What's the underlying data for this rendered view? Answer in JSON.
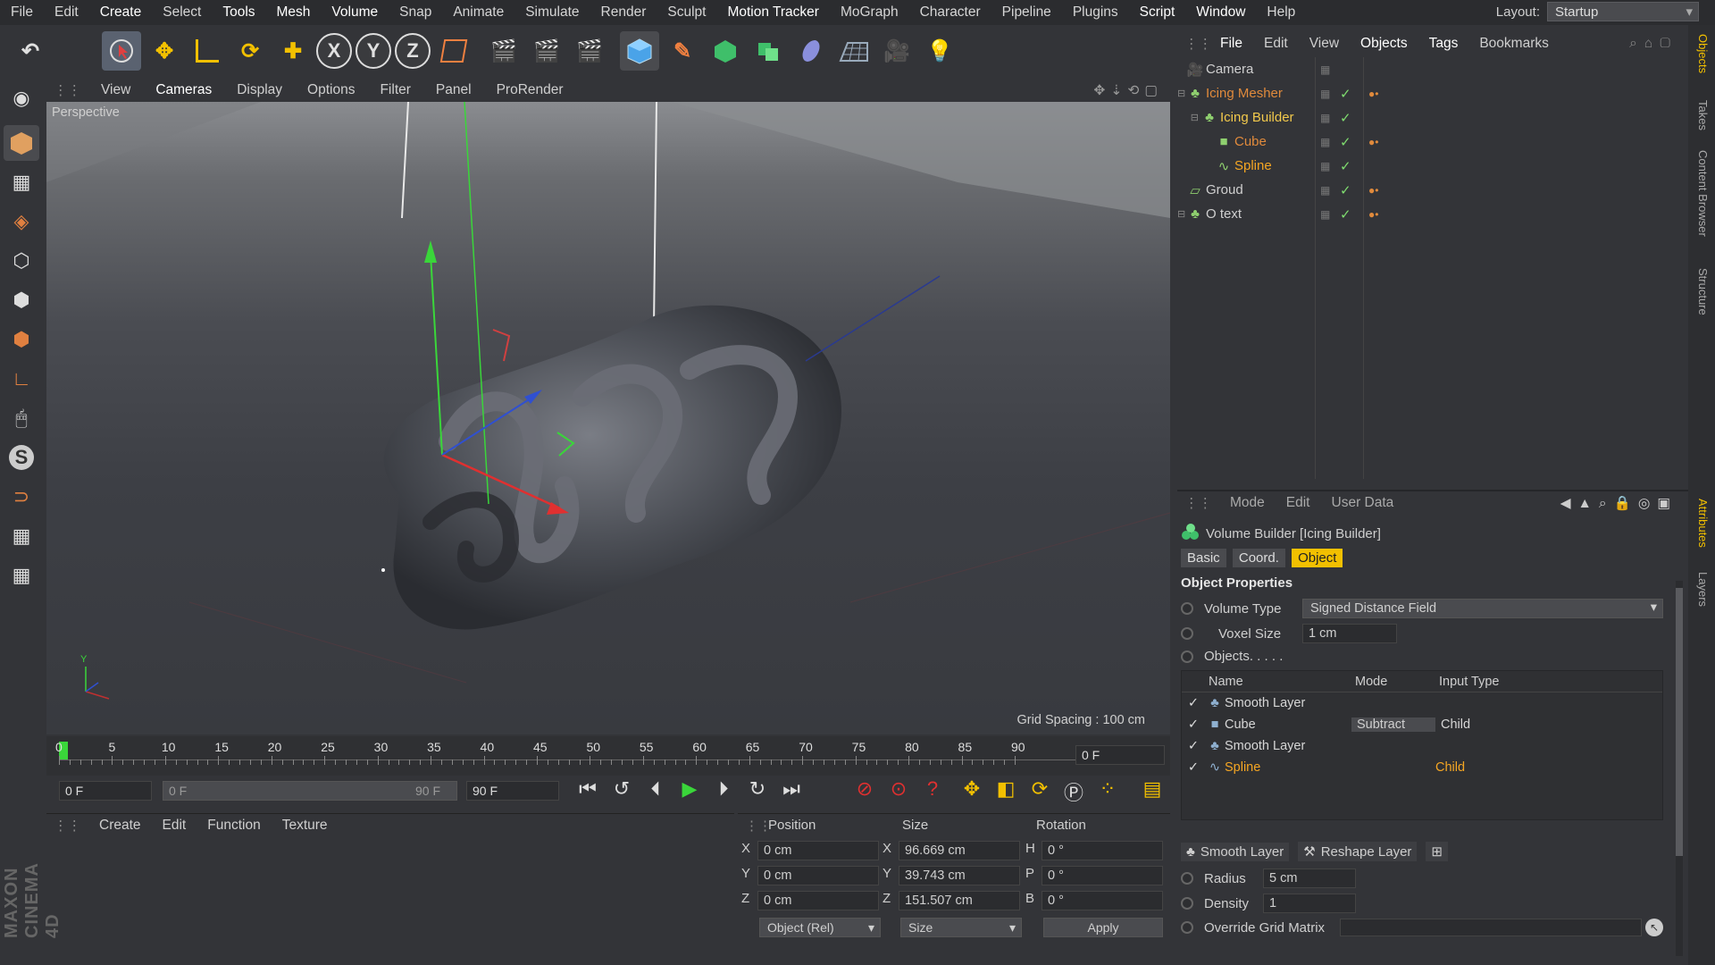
{
  "menubar": {
    "items": [
      "File",
      "Edit",
      "Create",
      "Select",
      "Tools",
      "Mesh",
      "Volume",
      "Snap",
      "Animate",
      "Simulate",
      "Render",
      "Sculpt",
      "Motion Tracker",
      "MoGraph",
      "Character",
      "Pipeline",
      "Plugins",
      "Script",
      "Window",
      "Help"
    ],
    "layout_label": "Layout:",
    "layout_value": "Startup"
  },
  "toolbar": {
    "axis_x": "X",
    "axis_y": "Y",
    "axis_z": "Z"
  },
  "viewport": {
    "menu": [
      "View",
      "Cameras",
      "Display",
      "Options",
      "Filter",
      "Panel",
      "ProRender"
    ],
    "label": "Perspective",
    "grid_spacing": "Grid Spacing : 100 cm",
    "axis_y": "Y"
  },
  "timeline": {
    "ticks": [
      "0",
      "5",
      "10",
      "15",
      "20",
      "25",
      "30",
      "35",
      "40",
      "45",
      "50",
      "55",
      "60",
      "65",
      "70",
      "75",
      "80",
      "85",
      "90"
    ],
    "current_frame": "0 F"
  },
  "transport": {
    "start_frame": "0 F",
    "range_start": "0 F",
    "range_end": "90 F",
    "end_frame": "90 F"
  },
  "material_panel": {
    "menu": [
      "Create",
      "Edit",
      "Function",
      "Texture"
    ],
    "brand_text": "MAXON CINEMA 4D"
  },
  "coord_panel": {
    "headers": {
      "position": "Position",
      "size": "Size",
      "rotation": "Rotation"
    },
    "rows": [
      {
        "axis": "X",
        "pos": "0 cm",
        "size_axis": "X",
        "size": "96.669 cm",
        "rot_axis": "H",
        "rot": "0 °"
      },
      {
        "axis": "Y",
        "pos": "0 cm",
        "size_axis": "Y",
        "size": "39.743 cm",
        "rot_axis": "P",
        "rot": "0 °"
      },
      {
        "axis": "Z",
        "pos": "0 cm",
        "size_axis": "Z",
        "size": "151.507 cm",
        "rot_axis": "B",
        "rot": "0 °"
      }
    ],
    "mode_select": "Object (Rel)",
    "size_select": "Size",
    "apply": "Apply"
  },
  "objects_panel": {
    "menu": [
      "File",
      "Edit",
      "View",
      "Objects",
      "Tags",
      "Bookmarks"
    ],
    "items": [
      {
        "name": "Camera",
        "color": "#cfcfcf",
        "indent": 0
      },
      {
        "name": "Icing Mesher",
        "color": "#e08a3c",
        "indent": 0
      },
      {
        "name": "Icing Builder",
        "color": "#f2c94c",
        "indent": 1
      },
      {
        "name": "Cube",
        "color": "#e08a3c",
        "indent": 2
      },
      {
        "name": "Spline",
        "color": "#f5a623",
        "indent": 2
      },
      {
        "name": "Groud",
        "color": "#cfcfcf",
        "indent": 0
      },
      {
        "name": "O text",
        "color": "#cfcfcf",
        "indent": 0
      }
    ]
  },
  "attributes_panel": {
    "menu": [
      "Mode",
      "Edit",
      "User Data"
    ],
    "title": "Volume Builder [Icing Builder]",
    "tabs": [
      "Basic",
      "Coord.",
      "Object"
    ],
    "active_tab": "Object",
    "section": "Object Properties",
    "volume_type_label": "Volume Type",
    "volume_type_value": "Signed Distance Field",
    "voxel_size_label": "Voxel Size",
    "voxel_size_value": "1 cm",
    "objects_label": "Objects. . . . .",
    "list_headers": {
      "name": "Name",
      "mode": "Mode",
      "input_type": "Input Type"
    },
    "list_rows": [
      {
        "name": "Smooth Layer",
        "mode": "",
        "input": ""
      },
      {
        "name": "Cube",
        "mode": "Subtract",
        "input": "Child"
      },
      {
        "name": "Smooth Layer",
        "mode": "",
        "input": ""
      },
      {
        "name": "Spline",
        "mode": "",
        "input": "Child"
      }
    ],
    "smooth_layer_btn": "Smooth Layer",
    "reshape_layer_btn": "Reshape Layer",
    "radius_label": "Radius",
    "radius_value": "5 cm",
    "density_label": "Density",
    "density_value": "1",
    "override_label": "Override Grid Matrix"
  },
  "right_strip": [
    "Objects",
    "Takes",
    "Content Browser",
    "Structure",
    "Attributes",
    "Layers"
  ],
  "colors": {
    "accent": "#f2c000",
    "highlight": "#f5a623",
    "check": "#7fdc6f"
  }
}
